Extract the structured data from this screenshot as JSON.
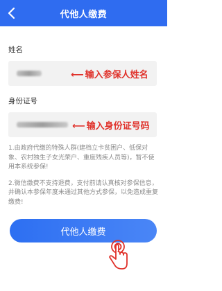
{
  "header": {
    "title": "代他人缴费",
    "back_icon": "chevron-left-icon",
    "color": "#2f6cf0"
  },
  "form": {
    "name_label": "姓名",
    "id_label": "身份证号"
  },
  "annotations": {
    "name_hint": "输入参保人姓名",
    "id_hint": "输入身份证号码",
    "arrow_icon": "left-arrow-icon",
    "color": "#e0322b"
  },
  "notes": [
    "1.由政府代缴的特殊人群(建档立卡贫困户、低保对象、农村独生子女光荣户、重度残疾人员等)，暂不使用本系统参保!",
    "2.微信缴费不支持退费，支付前请认真核对参保信息，并确认本参保年度未通过其他方式参保，以免造成重复缴费!"
  ],
  "submit_button": {
    "label": "代他人缴费",
    "color": "#2d6ff2"
  },
  "tap_indicator": {
    "icon": "pointing-hand-icon",
    "color": "#e0322b"
  }
}
